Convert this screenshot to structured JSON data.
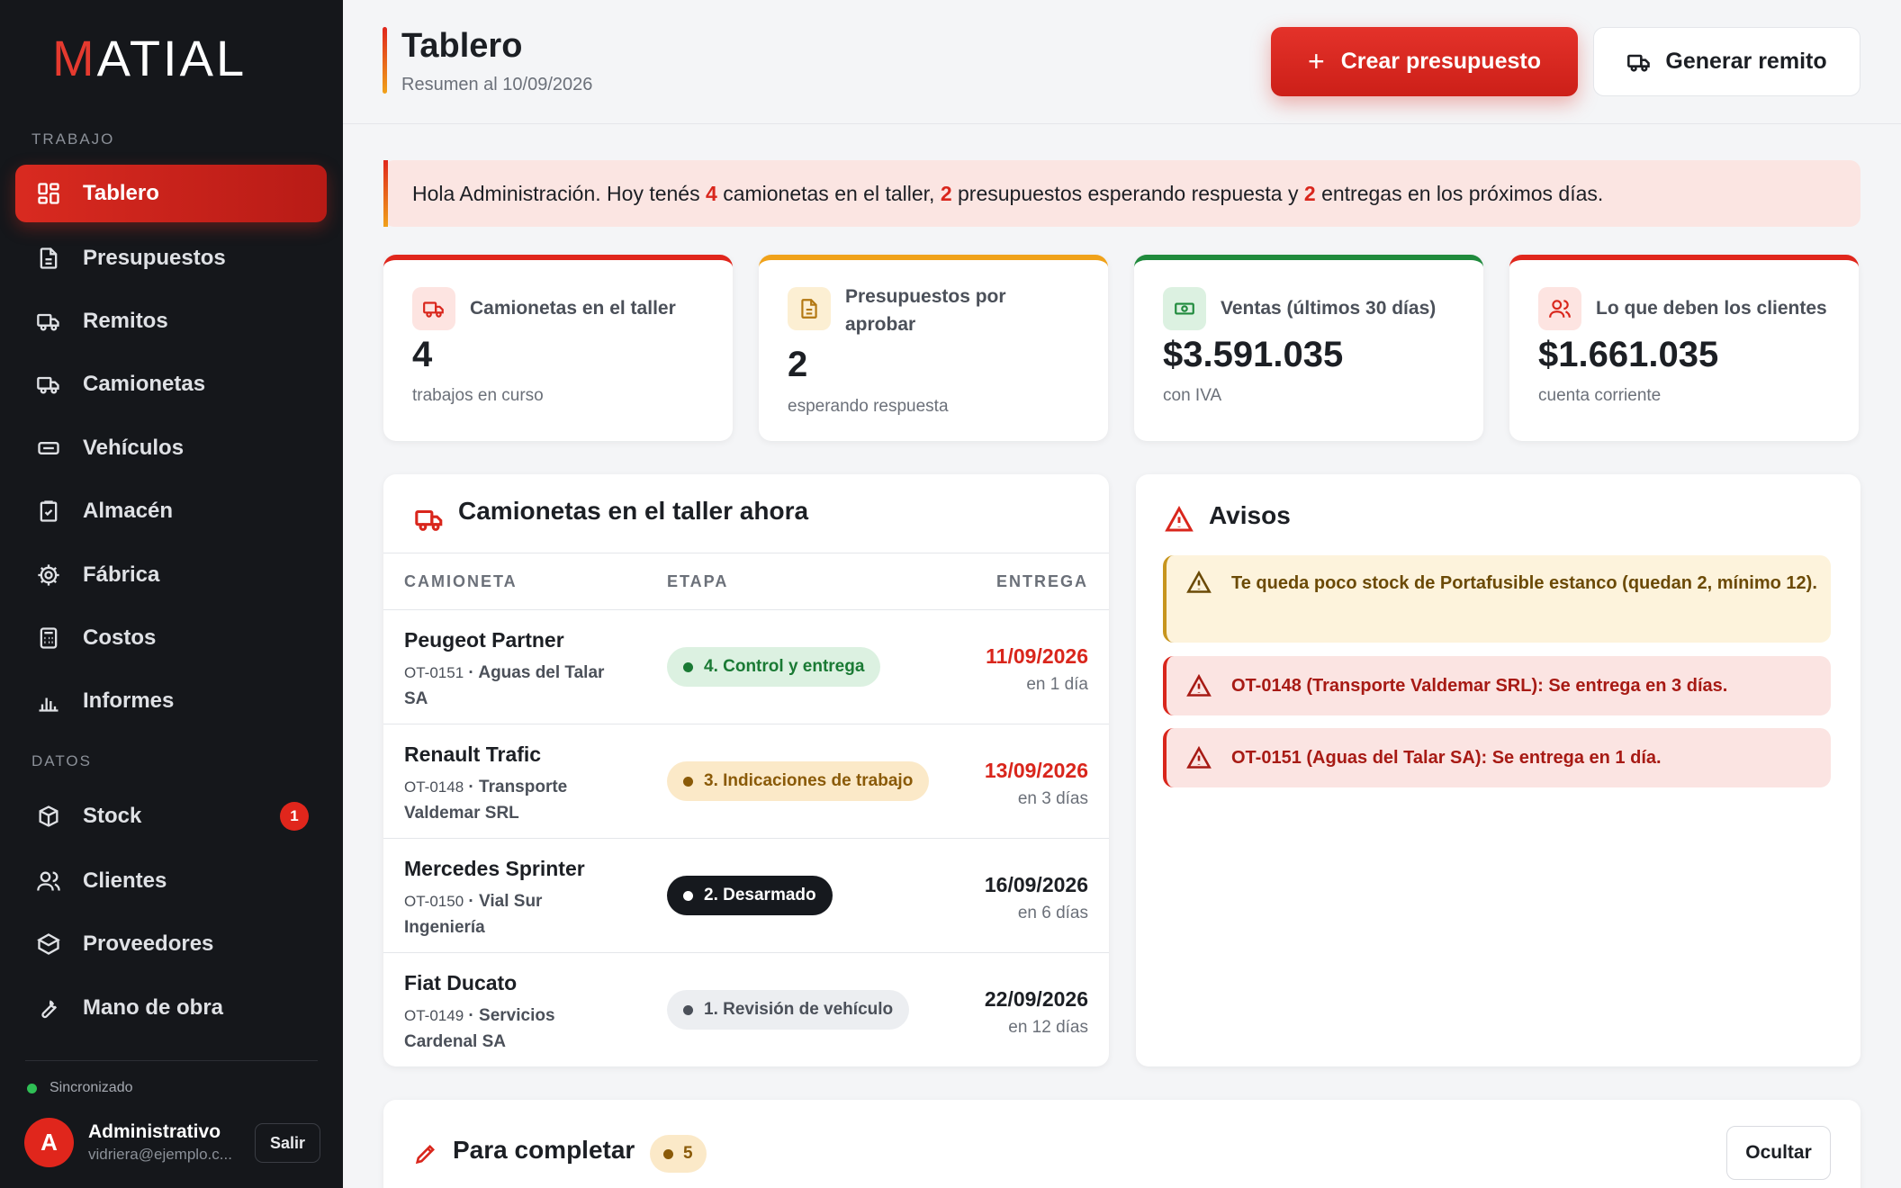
{
  "app": {
    "logo_accent": "M",
    "logo_rest": "ATIAL"
  },
  "sidebar": {
    "section_trabajo": "TRABAJO",
    "section_datos": "DATOS",
    "items": [
      {
        "label": "Tablero",
        "icon": "grid-icon"
      },
      {
        "label": "Presupuestos",
        "icon": "document-icon"
      },
      {
        "label": "Remitos",
        "icon": "truck-icon"
      },
      {
        "label": "Camionetas",
        "icon": "truck-icon"
      },
      {
        "label": "Vehículos",
        "icon": "card-icon"
      },
      {
        "label": "Almacén",
        "icon": "clipboard-icon"
      },
      {
        "label": "Fábrica",
        "icon": "gear-icon"
      },
      {
        "label": "Costos",
        "icon": "calculator-icon"
      },
      {
        "label": "Informes",
        "icon": "bar-chart-icon"
      }
    ],
    "data_items": [
      {
        "label": "Stock",
        "icon": "box-icon",
        "badge": "1"
      },
      {
        "label": "Clientes",
        "icon": "users-icon"
      },
      {
        "label": "Proveedores",
        "icon": "package-icon"
      },
      {
        "label": "Mano de obra",
        "icon": "wrench-icon"
      }
    ],
    "sync_status": "Sincronizado",
    "user": {
      "initial": "A",
      "name": "Administrativo",
      "email": "vidriera@ejemplo.c...",
      "logout": "Salir"
    }
  },
  "header": {
    "title": "Tablero",
    "subtitle": "Resumen al 10/09/2026",
    "primary_button": "Crear presupuesto",
    "primary_icon": "plus",
    "secondary_button": "Generar remito"
  },
  "greeting": {
    "part1": "Hola Administración. Hoy tenés ",
    "n1": "4",
    "part2": " camionetas en el taller, ",
    "n2": "2",
    "part3": " presupuestos esperando respuesta y ",
    "n3": "2",
    "part4": " entregas en los próximos días."
  },
  "stats": [
    {
      "title": "Camionetas en el taller",
      "value": "4",
      "sub": "trabajos en curso",
      "color": "#e0261c",
      "icon": "truck-icon"
    },
    {
      "title": "Presupuestos por aprobar",
      "value": "2",
      "sub": "esperando respuesta",
      "color": "#f0a21a",
      "icon": "document-icon"
    },
    {
      "title": "Ventas (últimos 30 días)",
      "value": "$3.591.035",
      "sub": "con IVA",
      "color": "#1f8a3c",
      "icon": "money-icon"
    },
    {
      "title": "Lo que deben los clientes",
      "value": "$1.661.035",
      "sub": "cuenta corriente",
      "color": "#e0261c",
      "icon": "users-icon"
    }
  ],
  "trucks": {
    "title": "Camionetas en el taller ahora",
    "columns": [
      "CAMIONETA",
      "ETAPA",
      "ENTREGA"
    ],
    "rows": [
      {
        "name": "Peugeot Partner",
        "code": "OT-0151",
        "client": "Aguas del Talar SA",
        "stage": "4. Control y entrega",
        "stage_kind": "green",
        "date": "11/09/2026",
        "rel": "en 1 día",
        "urgent": true
      },
      {
        "name": "Renault Trafic",
        "code": "OT-0148",
        "client": "Transporte Valdemar SRL",
        "stage": "3. Indicaciones de trabajo",
        "stage_kind": "amber",
        "date": "13/09/2026",
        "rel": "en 3 días",
        "urgent": true
      },
      {
        "name": "Mercedes Sprinter",
        "code": "OT-0150",
        "client": "Vial Sur Ingeniería",
        "stage": "2. Desarmado",
        "stage_kind": "dark",
        "date": "16/09/2026",
        "rel": "en 6 días",
        "urgent": false
      },
      {
        "name": "Fiat Ducato",
        "code": "OT-0149",
        "client": "Servicios Cardenal SA",
        "stage": "1. Revisión de vehículo",
        "stage_kind": "gray",
        "date": "22/09/2026",
        "rel": "en 12 días",
        "urgent": false
      }
    ]
  },
  "avisos": {
    "title": "Avisos",
    "items": [
      {
        "text": "Te queda poco stock de Portafusible estanco (quedan 2, mínimo 12).",
        "kind": "warning"
      },
      {
        "text": "OT-0148 (Transporte Valdemar SRL): Se entrega en 3 días.",
        "kind": "danger"
      },
      {
        "text": "OT-0151 (Aguas del Talar SA): Se entrega en 1 día.",
        "kind": "danger"
      }
    ]
  },
  "complete": {
    "title": "Para completar",
    "count": "5",
    "hide_button": "Ocultar"
  },
  "colors": {
    "accent": "#e0261c",
    "sidebar_bg": "#15171b",
    "warning": "#f0a21a",
    "success": "#1f8a3c"
  }
}
